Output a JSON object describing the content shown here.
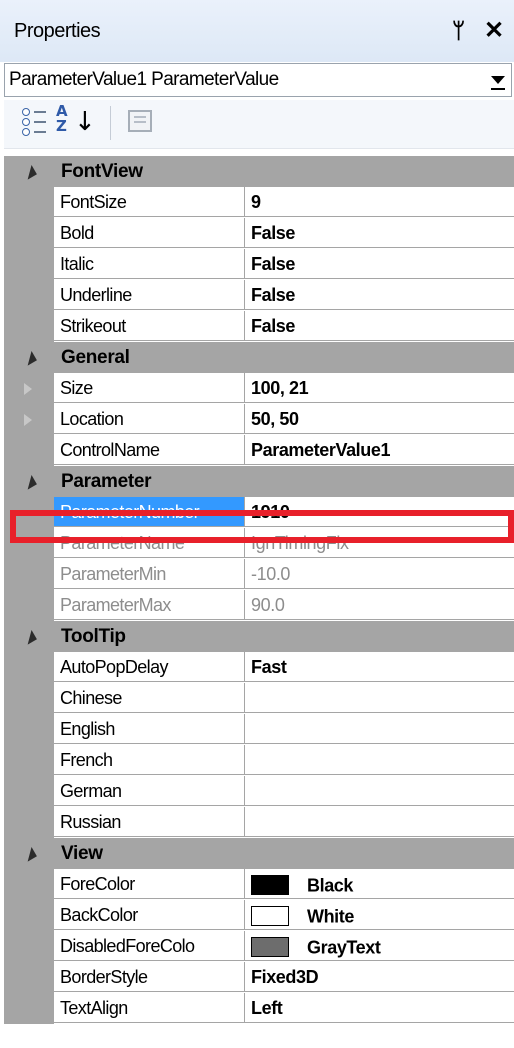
{
  "window": {
    "title": "Properties"
  },
  "selector": {
    "value": "ParameterValue1 ParameterValue"
  },
  "categories": {
    "fontview": "FontView",
    "general": "General",
    "parameter": "Parameter",
    "tooltip": "ToolTip",
    "view": "View"
  },
  "rows": {
    "fontsize": {
      "name": "FontSize",
      "value": "9"
    },
    "bold": {
      "name": "Bold",
      "value": "False"
    },
    "italic": {
      "name": "Italic",
      "value": "False"
    },
    "underline": {
      "name": "Underline",
      "value": "False"
    },
    "strikeout": {
      "name": "Strikeout",
      "value": "False"
    },
    "size": {
      "name": "Size",
      "value": "100, 21"
    },
    "location": {
      "name": "Location",
      "value": "50, 50"
    },
    "controlname": {
      "name": "ControlName",
      "value": "ParameterValue1"
    },
    "parameternumber": {
      "name": "ParameterNumber",
      "value": "1910"
    },
    "parametername": {
      "name": "ParameterName",
      "value": "IgnTimingFix"
    },
    "parametermin": {
      "name": "ParameterMin",
      "value": "-10.0"
    },
    "parametermax": {
      "name": "ParameterMax",
      "value": "90.0"
    },
    "autopopdelay": {
      "name": "AutoPopDelay",
      "value": "Fast"
    },
    "chinese": {
      "name": "Chinese",
      "value": ""
    },
    "english": {
      "name": "English",
      "value": ""
    },
    "french": {
      "name": "French",
      "value": ""
    },
    "german": {
      "name": "German",
      "value": ""
    },
    "russian": {
      "name": "Russian",
      "value": ""
    },
    "forecolor": {
      "name": "ForeColor",
      "value": "Black",
      "swatch": "#000000"
    },
    "backcolor": {
      "name": "BackColor",
      "value": "White",
      "swatch": "#ffffff"
    },
    "disabledforecolor": {
      "name": "DisabledForeColo",
      "value": "GrayText",
      "swatch": "#6d6d6d"
    },
    "borderstyle": {
      "name": "BorderStyle",
      "value": "Fixed3D"
    },
    "textalign": {
      "name": "TextAlign",
      "value": "Left"
    }
  },
  "icons": {
    "pin": "pin-icon",
    "close": "close-icon",
    "categorized": "categorized-view-icon",
    "alphabetical": "alphabetical-sort-icon",
    "property_pages": "property-pages-icon"
  },
  "colors": {
    "selection": "#3399ff",
    "highlight_box": "#e8202a",
    "gutter": "#a5a5a5"
  }
}
